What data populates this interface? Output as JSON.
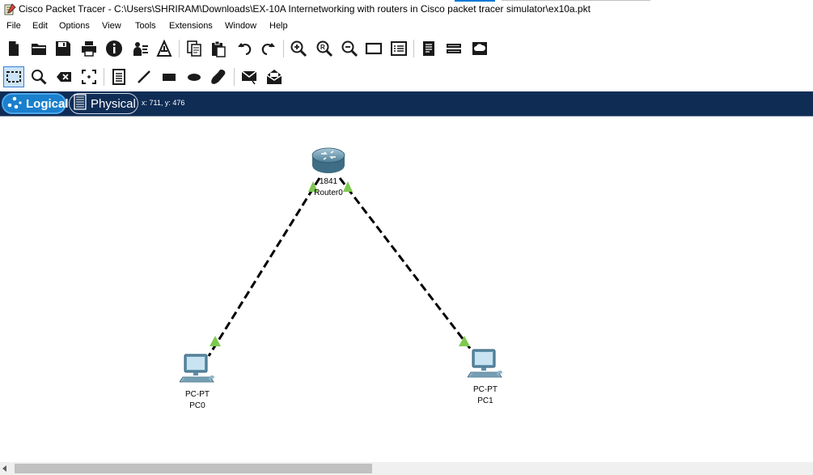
{
  "window": {
    "title": "Cisco Packet Tracer - C:\\Users\\SHRIRAM\\Downloads\\EX-10A Internetworking with routers in Cisco packet tracer simulator\\ex10a.pkt"
  },
  "menu": [
    "File",
    "Edit",
    "Options",
    "View",
    "Tools",
    "Extensions",
    "Window",
    "Help"
  ],
  "toolbar_main": [
    "new-icon",
    "open-icon",
    "save-icon",
    "print-icon",
    "info-icon",
    "network-wizard-icon",
    "activity-wizard-icon",
    "copy-icon",
    "paste-icon",
    "undo-icon",
    "redo-icon",
    "zoom-in-icon",
    "zoom-reset-icon",
    "zoom-out-icon",
    "drawing-palette-icon",
    "custom-device-dialog-icon",
    "viewport-icon",
    "cluster-icon",
    "cloud-icon"
  ],
  "toolbar_tools": [
    "select-tool-icon",
    "inspect-tool-icon",
    "delete-tool-icon",
    "resize-shape-tool-icon",
    "place-note-icon",
    "draw-line-icon",
    "draw-rectangle-icon",
    "draw-ellipse-icon",
    "draw-freeform-icon",
    "add-simple-pdu-icon",
    "add-complex-pdu-icon"
  ],
  "modes": {
    "logical": "Logical",
    "physical": "Physical"
  },
  "coordinates": "x: 711, y: 476",
  "devices": {
    "router": {
      "model": "1841",
      "name": "Router0"
    },
    "pc0": {
      "model": "PC-PT",
      "name": "PC0"
    },
    "pc1": {
      "model": "PC-PT",
      "name": "PC1"
    }
  },
  "colors": {
    "mode_bar": "#0f2c55",
    "logical_active": "#1a7fcc",
    "link_up": "#7ec850",
    "link_cable": "#000000"
  }
}
